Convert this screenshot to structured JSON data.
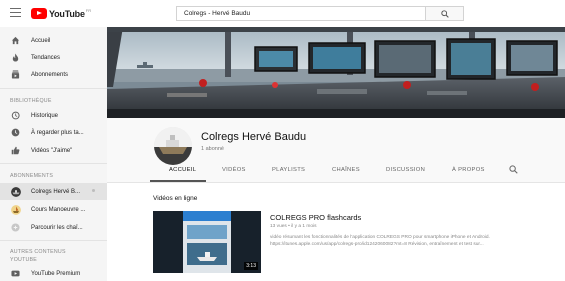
{
  "header": {
    "logo_text": "YouTube",
    "logo_sup": "FR",
    "search_value": "Colregs - Hervé Baudu"
  },
  "sidebar": {
    "main_items": [
      {
        "label": "Accueil",
        "icon": "home-icon"
      },
      {
        "label": "Tendances",
        "icon": "flame-icon"
      },
      {
        "label": "Abonnements",
        "icon": "subscriptions-icon"
      }
    ],
    "library_title": "BIBLIOTHÈQUE",
    "library_items": [
      {
        "label": "Historique",
        "icon": "history-icon"
      },
      {
        "label": "À regarder plus ta...",
        "icon": "clock-icon"
      },
      {
        "label": "Vidéos \"J'aime\"",
        "icon": "thumbs-up-icon"
      }
    ],
    "subs_title": "ABONNEMENTS",
    "subs_items": [
      {
        "label": "Colregs Hervé B...",
        "icon": "channel-avatar"
      },
      {
        "label": "Cours Manoeuvre ...",
        "icon": "channel-avatar"
      },
      {
        "label": "Parcourir les chaî...",
        "icon": "plus-circle-icon"
      }
    ],
    "more_title_line1": "AUTRES CONTENUS",
    "more_title_line2": "YOUTUBE",
    "more_items": [
      {
        "label": "YouTube Premium",
        "icon": "youtube-premium-icon"
      }
    ]
  },
  "channel": {
    "name": "Colregs Hervé Baudu",
    "subscribers": "1 abonné",
    "tabs": [
      "ACCUEIL",
      "VIDÉOS",
      "PLAYLISTS",
      "CHAÎNES",
      "DISCUSSION",
      "À PROPOS"
    ],
    "active_tab": "ACCUEIL"
  },
  "content": {
    "section_title": "Vidéos en ligne",
    "video": {
      "title": "COLREGS PRO flashcards",
      "meta": "13 vues • il y a 1 mois",
      "desc_line1": "vidéo résumant les fonctionnalités de l'application COLREGS PRO pour smartphone iPhone et Android.",
      "desc_line2": "https://itunes.apple.com/us/app/colregs-pro/id1242060082?mt=8 Révision, entraînement et test sur...",
      "duration": "3:13"
    }
  },
  "colors": {
    "accent": "#ff0000",
    "sidebar_bg": "#f5f5f5",
    "header_bg": "#f9f9f9"
  }
}
